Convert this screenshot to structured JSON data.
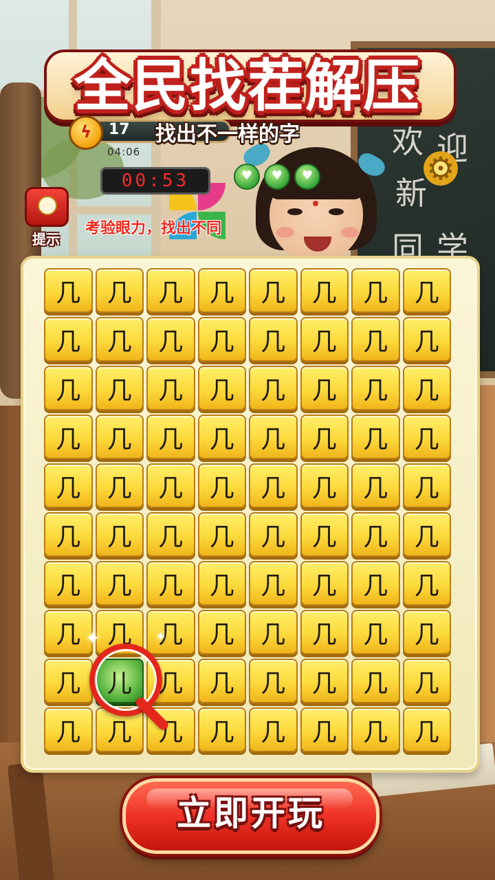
{
  "header": {
    "title": "全民找茬解压",
    "subtitle": "找出不一样的字",
    "level": "17",
    "level_icon": "lightning-coin-icon"
  },
  "status": {
    "small_time": "04:06",
    "timer": "00:53",
    "lives": 3
  },
  "hint": {
    "label": "提示",
    "icon": "lightbulb-icon"
  },
  "caption": "考验眼力，找出不同",
  "chalkboard": [
    "欢",
    "迎",
    "新",
    "同",
    "学"
  ],
  "grid": {
    "rows": 10,
    "cols": 8,
    "common_char": "几",
    "odd_char": "儿",
    "odd_position": {
      "row": 9,
      "col": 2
    }
  },
  "play_button": {
    "label": "立即开玩"
  },
  "colors": {
    "title_outline": "#c0211d",
    "tile": "#fcd93b",
    "odd_tile": "#55b23c",
    "button": "#ef3126",
    "timer_text": "#ff2a2a"
  }
}
